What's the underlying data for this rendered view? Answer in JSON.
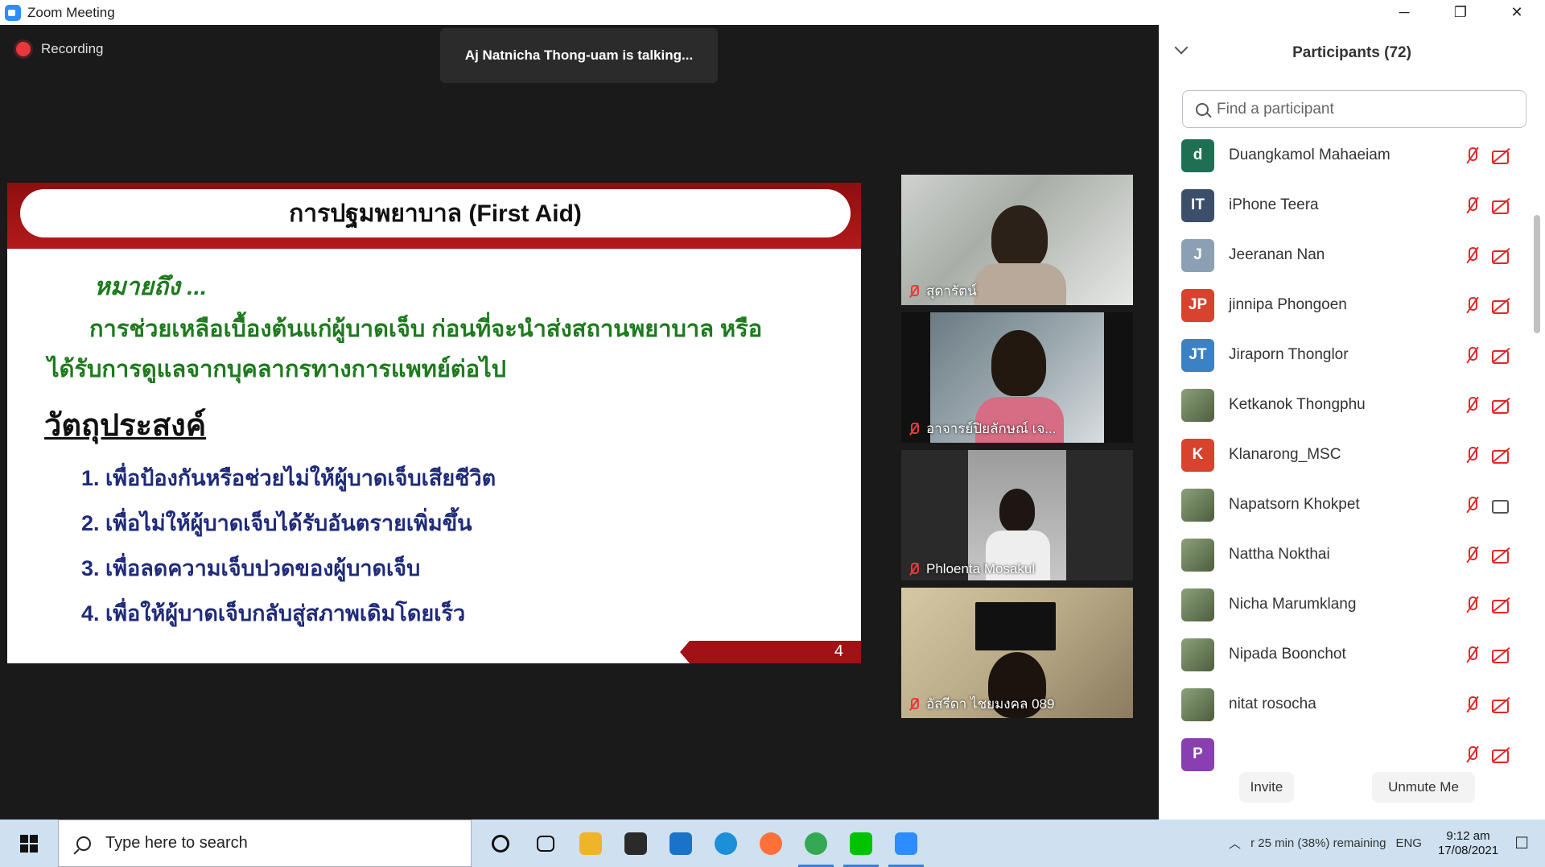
{
  "window": {
    "title": "Zoom Meeting",
    "minimize": "─",
    "restore": "❐",
    "close": "✕"
  },
  "meeting": {
    "recording_label": "Recording",
    "talking_banner": "Aj Natnicha Thong-uam is talking..."
  },
  "slide": {
    "title": "การปฐมพยาบาล (First Aid)",
    "meaning": "หมายถึง ...",
    "description_line1": "การช่วยเหลือเบื้องต้นแก่ผู้บาดเจ็บ ก่อนที่จะนำส่งสถานพยาบาล หรือ",
    "description_line2": "ได้รับการดูแลจากบุคลากรทางการแพทย์ต่อไป",
    "objective_heading": "วัตถุประสงค์",
    "objectives": [
      "1. เพื่อป้องกันหรือช่วยไม่ให้ผู้บาดเจ็บเสียชีวิต",
      "2. เพื่อไม่ให้ผู้บาดเจ็บได้รับอันตรายเพิ่มขึ้น",
      "3. เพื่อลดความเจ็บปวดของผู้บาดเจ็บ",
      "4. เพื่อให้ผู้บาดเจ็บกลับสู่สภาพเดิมโดยเร็ว"
    ],
    "page_number": "4",
    "header_color": "#a01214",
    "text_green": "#1e7a1e",
    "text_blue": "#1f2a7a"
  },
  "video_tiles": [
    {
      "name": "สุดารัตน์",
      "muted": true
    },
    {
      "name": "อาจารย์ปิยลักษณ์ เจ...",
      "muted": true
    },
    {
      "name": "Phloenta Mosakul",
      "muted": true
    },
    {
      "name": "อัสรีดา ไชยมงคล 089",
      "muted": true
    }
  ],
  "participants": {
    "title": "Participants (72)",
    "search_placeholder": "Find a participant",
    "items": [
      {
        "initials": "d",
        "name": "Duangkamol Mahaeiam",
        "color": "#1f6f52",
        "photo": false,
        "cam_on": false
      },
      {
        "initials": "IT",
        "name": "iPhone Teera",
        "color": "#3b4f6b",
        "photo": false,
        "cam_on": false
      },
      {
        "initials": "J",
        "name": "Jeeranan Nan",
        "color": "#8ba1b3",
        "photo": false,
        "cam_on": false
      },
      {
        "initials": "JP",
        "name": "jinnipa Phongoen",
        "color": "#d8432e",
        "photo": false,
        "cam_on": false
      },
      {
        "initials": "JT",
        "name": "Jiraporn Thonglor",
        "color": "#3b82c4",
        "photo": false,
        "cam_on": false
      },
      {
        "initials": "",
        "name": "Ketkanok Thongphu",
        "color": "#4f6a8a",
        "photo": true,
        "cam_on": false
      },
      {
        "initials": "K",
        "name": "Klanarong_MSC",
        "color": "#d8432e",
        "photo": false,
        "cam_on": false
      },
      {
        "initials": "",
        "name": "Napatsorn Khokpet",
        "color": "#b05030",
        "photo": true,
        "cam_on": true
      },
      {
        "initials": "",
        "name": "Nattha Nokthai",
        "color": "#a03030",
        "photo": true,
        "cam_on": false
      },
      {
        "initials": "",
        "name": "Nicha Marumklang",
        "color": "#6a8aa0",
        "photo": true,
        "cam_on": false
      },
      {
        "initials": "",
        "name": "Nipada Boonchot",
        "color": "#9aa0a8",
        "photo": true,
        "cam_on": false
      },
      {
        "initials": "",
        "name": "nitat rosocha",
        "color": "#5f7a4e",
        "photo": true,
        "cam_on": false
      },
      {
        "initials": "P",
        "name": "",
        "color": "#8a3fb0",
        "photo": false,
        "cam_on": false
      }
    ],
    "invite_label": "Invite",
    "unmute_label": "Unmute Me"
  },
  "taskbar": {
    "search_placeholder": "Type here to search",
    "apps": [
      {
        "name": "cortana",
        "color": "#111111"
      },
      {
        "name": "task-view",
        "color": "#111111"
      },
      {
        "name": "file-explorer",
        "color": "#f0b429"
      },
      {
        "name": "store",
        "color": "#2a2a2a"
      },
      {
        "name": "mail",
        "color": "#1a73c8"
      },
      {
        "name": "edge",
        "color": "#1b8fd8"
      },
      {
        "name": "firefox",
        "color": "#ff7139"
      },
      {
        "name": "chrome",
        "color": "#34a853"
      },
      {
        "name": "line",
        "color": "#00c300"
      },
      {
        "name": "zoom",
        "color": "#2D8CFF"
      }
    ],
    "tray_text": "r 25 min (38%) remaining",
    "lang": "ENG",
    "time": "9:12 am",
    "date": "17/08/2021"
  }
}
